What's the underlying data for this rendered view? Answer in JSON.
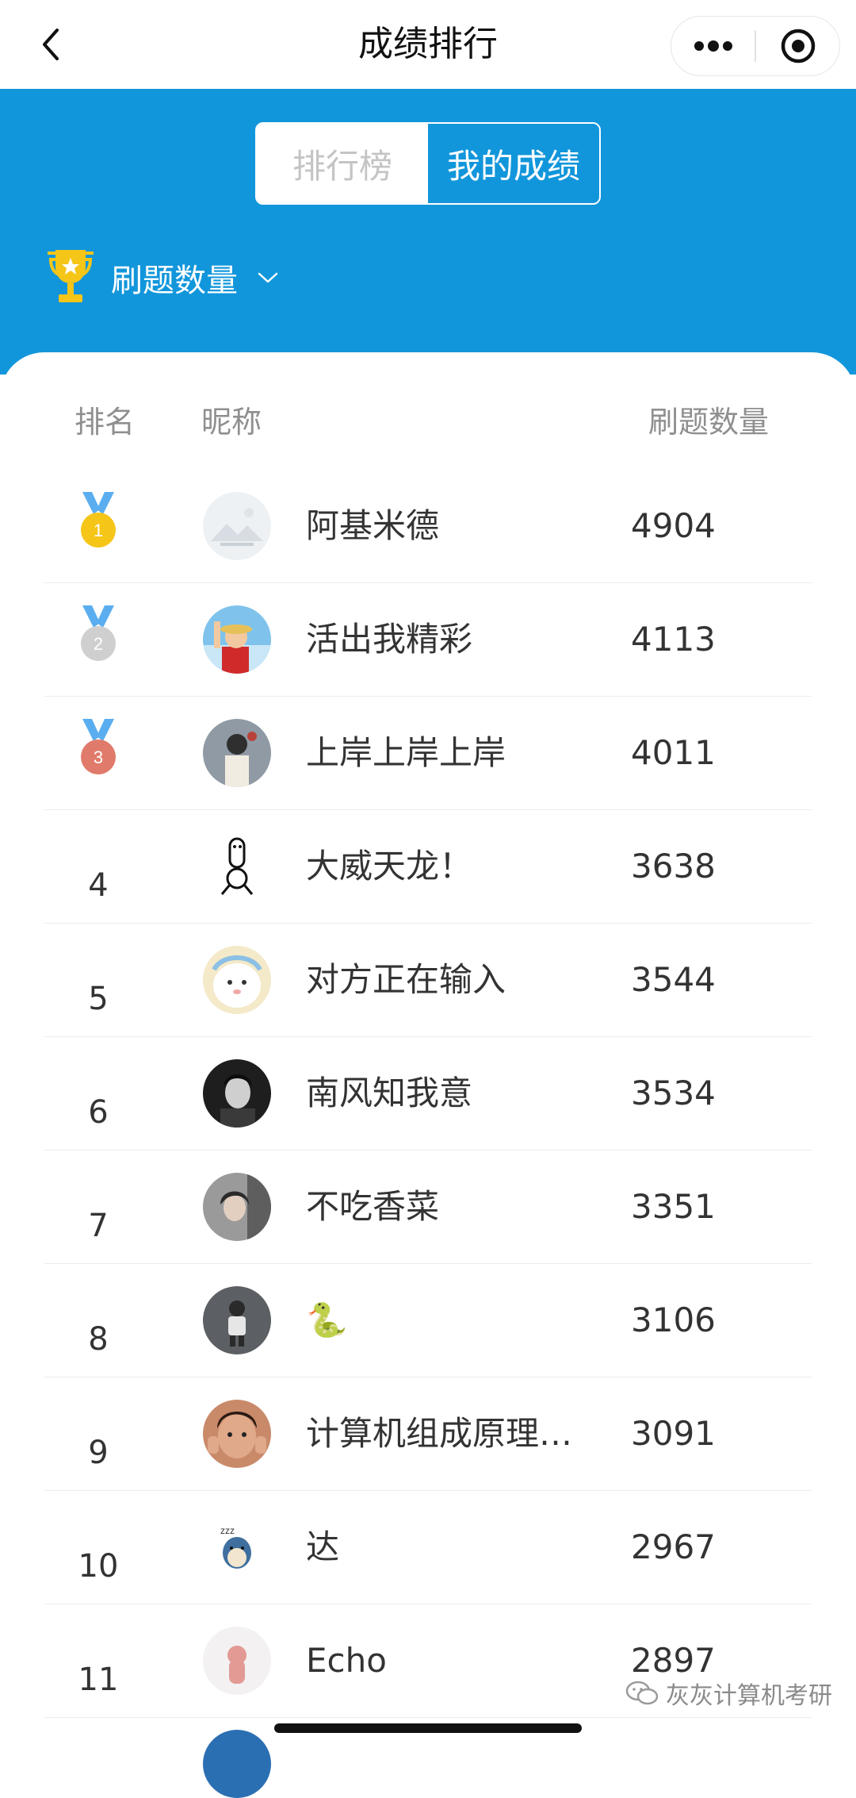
{
  "header": {
    "title": "成绩排行"
  },
  "tabs": {
    "ranking_label": "排行榜",
    "my_score_label": "我的成绩",
    "active": "我的成绩"
  },
  "metric": {
    "label": "刷题数量"
  },
  "table": {
    "columns": {
      "rank": "排名",
      "nickname": "昵称",
      "count": "刷题数量"
    },
    "rows": [
      {
        "rank": "1",
        "medal": "gold",
        "nickname": "阿基米德",
        "count": "4904"
      },
      {
        "rank": "2",
        "medal": "silver",
        "nickname": "活出我精彩",
        "count": "4113"
      },
      {
        "rank": "3",
        "medal": "bronze",
        "nickname": "上岸上岸上岸",
        "count": "4011"
      },
      {
        "rank": "4",
        "nickname": "大威天龙！",
        "count": "3638"
      },
      {
        "rank": "5",
        "nickname": "对方正在输入",
        "count": "3544"
      },
      {
        "rank": "6",
        "nickname": "南风知我意",
        "count": "3534"
      },
      {
        "rank": "7",
        "nickname": "不吃香菜",
        "count": "3351"
      },
      {
        "rank": "8",
        "nickname": "🐍",
        "count": "3106"
      },
      {
        "rank": "9",
        "nickname": "计算机组成原理…",
        "count": "3091"
      },
      {
        "rank": "10",
        "nickname": "达",
        "count": "2967"
      },
      {
        "rank": "11",
        "nickname": "Echo",
        "count": "2897"
      }
    ]
  },
  "watermark": {
    "text": "灰灰计算机考研"
  },
  "colors": {
    "brand_blue": "#1296db",
    "gold": "#f5c518",
    "silver": "#cfcfcf",
    "bronze": "#e07b6b",
    "ribbon": "#5aaef0"
  },
  "icons": {
    "back": "chevron-left-icon",
    "more": "more-dots-icon",
    "close": "target-circle-icon",
    "trophy": "trophy-icon",
    "dropdown": "chevron-down-icon",
    "watermark": "wechat-icon"
  }
}
